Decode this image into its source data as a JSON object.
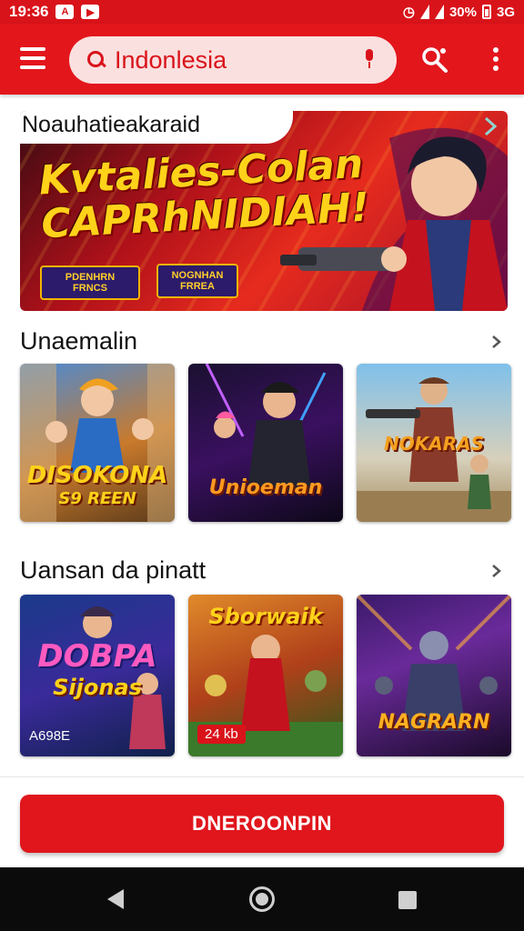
{
  "status_bar": {
    "time": "19:36",
    "battery": "30%",
    "extra": "3G"
  },
  "search": {
    "value": "Indonlesia"
  },
  "banner": {
    "title": "Noauhatieakaraid",
    "headline_line1": "Kvtalies-Colan",
    "headline_line2": "CAPRhNIDIAH!",
    "chip1": "PDENHRN\nFRNCS",
    "chip2": "NOGNHAN\nFRREA"
  },
  "section1": {
    "title": "Unaemalin",
    "tiles": [
      {
        "logo": "DISOKONA",
        "sub": "S9 REEN"
      },
      {
        "logo": "Unioeman"
      },
      {
        "logo": "NOKARAS"
      }
    ]
  },
  "section2": {
    "title": "Uansan da pinatt",
    "tiles": [
      {
        "logo": "DOBPA",
        "sub": "Sijonas",
        "tag": "A698E"
      },
      {
        "logo": "Sborwaik",
        "tag": "24 kb"
      },
      {
        "logo": "NAGRARN"
      }
    ]
  },
  "cta": {
    "label": "DNEROONPIN"
  },
  "colors": {
    "brand_red": "#e3161c",
    "accent_gold": "#ffd21a"
  }
}
